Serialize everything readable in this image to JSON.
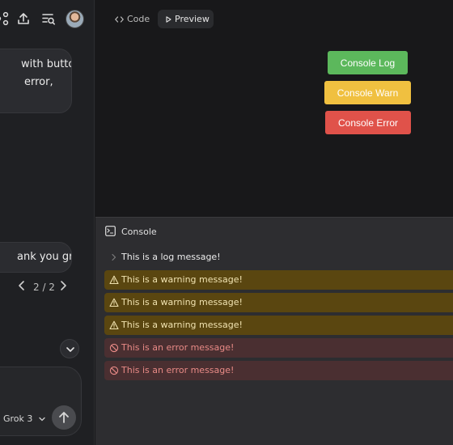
{
  "chat": {
    "message1_lines": [
      "with buttons",
      "error,"
    ],
    "message2": "ank you groky",
    "pager": {
      "text": "2 / 2",
      "prev_icon": "chevron-left-icon",
      "next_icon": "chevron-right-icon"
    },
    "model_selector": "Grok 3",
    "top_icons": [
      "share-icon",
      "upload-icon",
      "history-search-icon"
    ]
  },
  "artifact": {
    "tabs": [
      {
        "label": "Code",
        "icon": "code-icon"
      },
      {
        "label": "Preview",
        "icon": "play-icon",
        "active": true
      }
    ],
    "preview_buttons": {
      "log": "Console Log",
      "warn": "Console Warn",
      "error": "Console Error"
    },
    "console": {
      "title": "Console",
      "entries": [
        {
          "level": "log",
          "text": "This is a log message!"
        },
        {
          "level": "warn",
          "text": "This is a warning message!"
        },
        {
          "level": "warn",
          "text": "This is a warning message!"
        },
        {
          "level": "warn",
          "text": "This is a warning message!"
        },
        {
          "level": "error",
          "text": "This is an error message!"
        },
        {
          "level": "error",
          "text": "This is an error message!"
        }
      ]
    }
  },
  "colors": {
    "log_button": "#5cb85c",
    "warn_button": "#f0c040",
    "error_button": "#e0524a",
    "warn_row": "#5a4610",
    "error_row": "#4a2f31"
  }
}
